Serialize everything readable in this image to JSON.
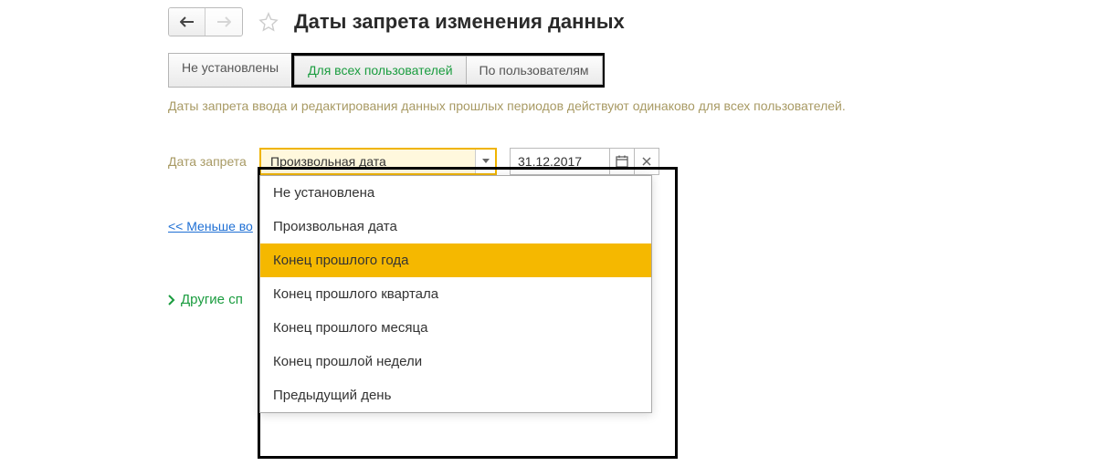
{
  "header": {
    "title": "Даты запрета изменения данных"
  },
  "tabs": {
    "items": [
      {
        "label": "Не установлены"
      },
      {
        "label": "Для всех пользователей"
      },
      {
        "label": "По пользователям"
      }
    ]
  },
  "description": "Даты запрета ввода и редактирования данных прошлых периодов действуют одинаково для всех пользователей.",
  "form": {
    "date_label": "Дата запрета",
    "dropdown_value": "Произвольная дата",
    "date_value": "31.12.2017"
  },
  "dropdown_options": [
    {
      "label": "Не установлена"
    },
    {
      "label": "Произвольная дата"
    },
    {
      "label": "Конец прошлого года"
    },
    {
      "label": "Конец прошлого квартала"
    },
    {
      "label": "Конец прошлого месяца"
    },
    {
      "label": "Конец прошлой недели"
    },
    {
      "label": "Предыдущий день"
    }
  ],
  "links": {
    "less": "<< Меньше во",
    "other": "Другие сп"
  }
}
